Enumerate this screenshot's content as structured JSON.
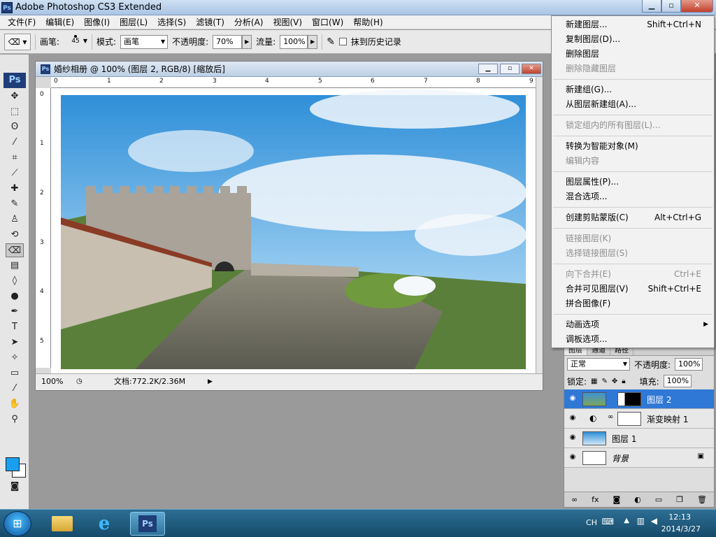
{
  "app": {
    "title": "Adobe Photoshop CS3 Extended",
    "badge": "Ps",
    "window_buttons": {
      "minimize": "▁",
      "restore": "▫",
      "close": "✕"
    }
  },
  "menubar": [
    "文件(F)",
    "编辑(E)",
    "图像(I)",
    "图层(L)",
    "选择(S)",
    "滤镜(T)",
    "分析(A)",
    "视图(V)",
    "窗口(W)",
    "帮助(H)"
  ],
  "options_bar": {
    "brush_label": "画笔:",
    "brush_size": "45",
    "mode_label": "模式:",
    "mode_value": "画笔",
    "opacity_label": "不透明度:",
    "opacity_value": "70%",
    "flow_label": "流量:",
    "flow_value": "100%",
    "erase_history_label": "抹到历史记录"
  },
  "toolbox": {
    "badge": "Ps",
    "foreground_color": "#1a9ff0",
    "background_color": "#ffffff"
  },
  "document": {
    "title": "婚纱相册 @ 100% (图层 2, RGB/8) [缩放后]",
    "zoom": "100%",
    "doc_info": "文档:772.2K/2.36M",
    "ruler_top": [
      "0",
      "1",
      "2",
      "3",
      "4",
      "5",
      "6",
      "7",
      "8",
      "9"
    ],
    "ruler_left": [
      "0",
      "1",
      "2",
      "3",
      "4",
      "5"
    ]
  },
  "context_menu": {
    "items": [
      {
        "label": "新建图层...",
        "shortcut": "Shift+Ctrl+N",
        "enabled": true
      },
      {
        "label": "复制图层(D)...",
        "shortcut": "",
        "enabled": true
      },
      {
        "label": "删除图层",
        "shortcut": "",
        "enabled": true
      },
      {
        "label": "删除隐藏图层",
        "shortcut": "",
        "enabled": false
      },
      {
        "sep": true
      },
      {
        "label": "新建组(G)...",
        "shortcut": "",
        "enabled": true
      },
      {
        "label": "从图层新建组(A)...",
        "shortcut": "",
        "enabled": true
      },
      {
        "sep": true
      },
      {
        "label": "锁定组内的所有图层(L)...",
        "shortcut": "",
        "enabled": false
      },
      {
        "sep": true
      },
      {
        "label": "转换为智能对象(M)",
        "shortcut": "",
        "enabled": true
      },
      {
        "label": "编辑内容",
        "shortcut": "",
        "enabled": false
      },
      {
        "sep": true
      },
      {
        "label": "图层属性(P)...",
        "shortcut": "",
        "enabled": true
      },
      {
        "label": "混合选项...",
        "shortcut": "",
        "enabled": true
      },
      {
        "sep": true
      },
      {
        "label": "创建剪贴蒙版(C)",
        "shortcut": "Alt+Ctrl+G",
        "enabled": true
      },
      {
        "sep": true
      },
      {
        "label": "链接图层(K)",
        "shortcut": "",
        "enabled": false
      },
      {
        "label": "选择链接图层(S)",
        "shortcut": "",
        "enabled": false
      },
      {
        "sep": true
      },
      {
        "label": "向下合并(E)",
        "shortcut": "Ctrl+E",
        "enabled": false
      },
      {
        "label": "合并可见图层(V)",
        "shortcut": "Shift+Ctrl+E",
        "enabled": true
      },
      {
        "label": "拼合图像(F)",
        "shortcut": "",
        "enabled": true
      },
      {
        "sep": true
      },
      {
        "label": "动画选项",
        "shortcut": "",
        "enabled": true,
        "submenu": true
      },
      {
        "label": "调板选项...",
        "shortcut": "",
        "enabled": true
      }
    ]
  },
  "layers_panel": {
    "tabs": [
      "图层",
      "通道",
      "路径"
    ],
    "blend_mode": "正常",
    "opacity_label": "不透明度:",
    "opacity_value": "100%",
    "lock_label": "锁定:",
    "fill_label": "填充:",
    "fill_value": "100%",
    "layers": [
      {
        "name": "图层 2",
        "selected": true
      },
      {
        "name": "渐变映射 1",
        "selected": false
      },
      {
        "name": "图层 1",
        "selected": false
      },
      {
        "name": "背景",
        "selected": false
      }
    ],
    "bottom_icons": [
      "link-icon",
      "fx-icon",
      "mask-icon",
      "adjustment-icon",
      "group-icon",
      "new-layer-icon",
      "trash-icon"
    ]
  },
  "taskbar": {
    "lang": "CH",
    "time": "12:13",
    "date": "2014/3/27",
    "ps_badge": "Ps"
  }
}
